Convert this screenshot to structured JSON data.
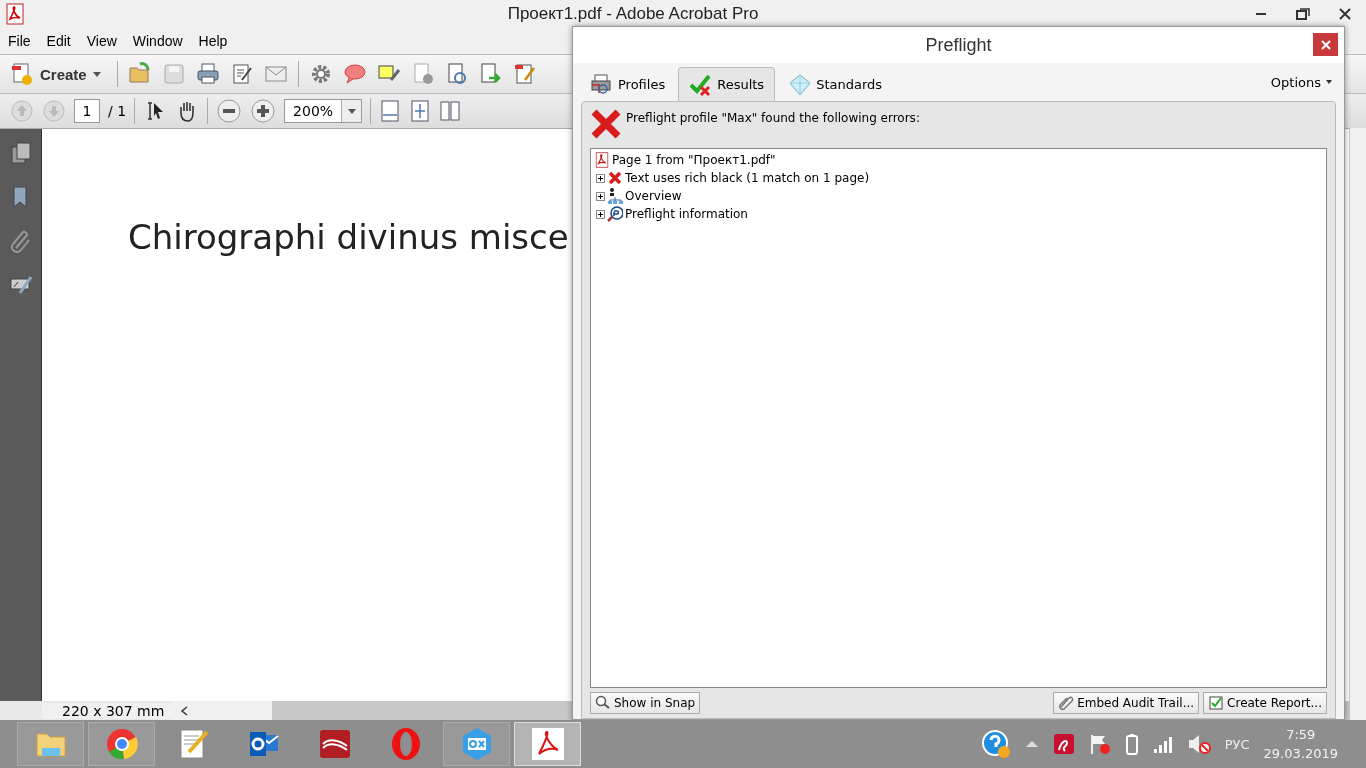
{
  "window": {
    "title": "Проект1.pdf - Adobe Acrobat Pro"
  },
  "menu": [
    "File",
    "Edit",
    "View",
    "Window",
    "Help"
  ],
  "toolbar": {
    "create_label": "Create"
  },
  "page_nav": {
    "page": "1",
    "total": "/ 1",
    "zoom": "200%"
  },
  "document": {
    "heading": "Chirographi divinus misce",
    "page_size": "220 x 307 mm"
  },
  "preflight": {
    "title": "Preflight",
    "tabs": [
      {
        "label": "Profiles",
        "kind": "profiles",
        "selected": false
      },
      {
        "label": "Results",
        "kind": "results",
        "selected": true
      },
      {
        "label": "Standards",
        "kind": "standards",
        "selected": false
      }
    ],
    "options": "Options",
    "message": "Preflight profile \"Max\" found the following errors:",
    "tree": [
      {
        "label": "Page 1 from \"Проект1.pdf\"",
        "kind": "page",
        "children": [
          {
            "label": "Text uses rich black (1 match on 1 page)",
            "kind": "error",
            "expanded": false
          },
          {
            "label": "Overview",
            "kind": "overview",
            "expanded": false
          },
          {
            "label": "Preflight information",
            "kind": "info",
            "expanded": false
          }
        ]
      }
    ],
    "buttons": [
      {
        "label": "Show in Snap",
        "kind": "snap"
      },
      {
        "label": "Embed Audit Trail...",
        "kind": "embed"
      },
      {
        "label": "Create Report...",
        "kind": "report"
      }
    ]
  },
  "taskbar": {
    "apps": [
      {
        "kind": "folder",
        "running": true,
        "selected": false
      },
      {
        "kind": "chrome",
        "running": true,
        "selected": false
      },
      {
        "kind": "notepad",
        "running": false,
        "selected": false
      },
      {
        "kind": "mail",
        "running": false,
        "selected": false
      },
      {
        "kind": "book",
        "running": false,
        "selected": false
      },
      {
        "kind": "opera",
        "running": false,
        "selected": false
      },
      {
        "kind": "qx",
        "running": true,
        "selected": false
      },
      {
        "kind": "pdf",
        "running": true,
        "selected": true
      }
    ],
    "language": "РУС",
    "time": "7:59",
    "date": "29.03.2019"
  }
}
